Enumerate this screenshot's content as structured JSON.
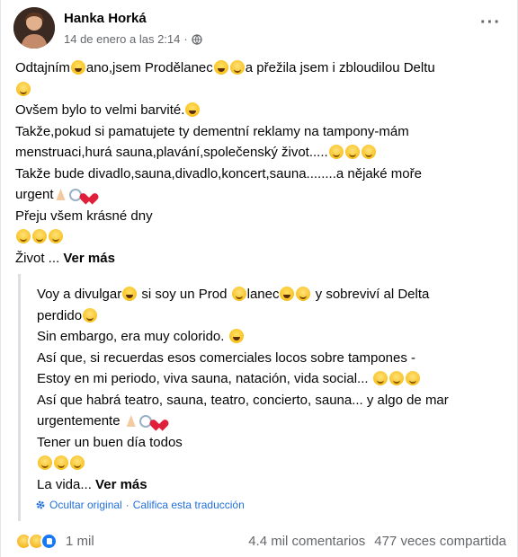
{
  "post": {
    "author": "Hanka Horká",
    "timestamp": "14 de enero a las 2:14",
    "separator": "·",
    "more_label": "···",
    "lines": {
      "l1a": "Odtajním",
      "l1b": "ano,jsem Prodělanec",
      "l1c": "a přežila jsem i zbloudilou Deltu",
      "l3": "Ovšem bylo to velmi barvité.",
      "l4": "Takže,pokud si pamatujete ty dementní reklamy na tampony-mám",
      "l5": "menstruaci,hurá sauna,plavání,společenský život.....",
      "l6": "Takže bude divadlo,sauna,divadlo,koncert,sauna........a nějaké moře",
      "l7": "urgent",
      "l8": "Přeju všem krásné dny",
      "l10": "Život ...",
      "see_more": "Ver más"
    }
  },
  "translation": {
    "lines": {
      "t1a": "Voy a divulgar",
      "t1b": " si soy un Prod ",
      "t1c": "lanec",
      "t1d": " y sobreviví al Delta",
      "t2": "perdido",
      "t3": "Sin embargo, era muy colorido. ",
      "t4": "Así que, si recuerdas esos comerciales locos sobre tampones -",
      "t5": "Estoy en mi periodo, viva sauna, natación, vida social... ",
      "t6": "Así que habrá teatro, sauna, teatro, concierto, sauna... y algo de mar",
      "t7": "urgentemente ",
      "t8": "Tener un buen día todos",
      "t10": "La vida...",
      "see_more": "Ver más"
    },
    "footer": {
      "hide_original": "Ocultar original",
      "dot": "·",
      "rate_translation": "Califica esta traducción"
    }
  },
  "stats": {
    "reactions_count": "1 mil",
    "comments": "4.4 mil comentarios",
    "shares": "477 veces compartida"
  },
  "colors": {
    "link_blue": "#216fdb",
    "meta_gray": "#65676b",
    "like_blue": "#1877f2"
  },
  "icons": [
    "globe-icon",
    "more-options-icon",
    "gear-icon",
    "laughing-face-emoji",
    "winking-face-emoji",
    "smiling-face-emoji",
    "praying-hands-emoji",
    "swirl-emoji",
    "red-heart-emoji",
    "sad-reaction-icon",
    "haha-reaction-icon",
    "like-reaction-icon"
  ]
}
